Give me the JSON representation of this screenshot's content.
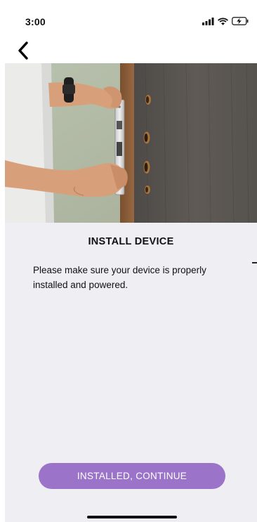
{
  "status_bar": {
    "time": "3:00",
    "icons": [
      "signal-icon",
      "wifi-icon",
      "battery-charging-icon"
    ]
  },
  "nav": {
    "back_icon": "chevron-left-icon"
  },
  "hero": {
    "image": "hands-installing-lock-in-door-photo"
  },
  "content": {
    "title": "INSTALL DEVICE",
    "description": "Please make sure your device is properly installed and powered."
  },
  "actions": {
    "continue_label": "INSTALLED, CONTINUE"
  },
  "colors": {
    "accent": "#9b74ca",
    "background": "#efeef3"
  }
}
